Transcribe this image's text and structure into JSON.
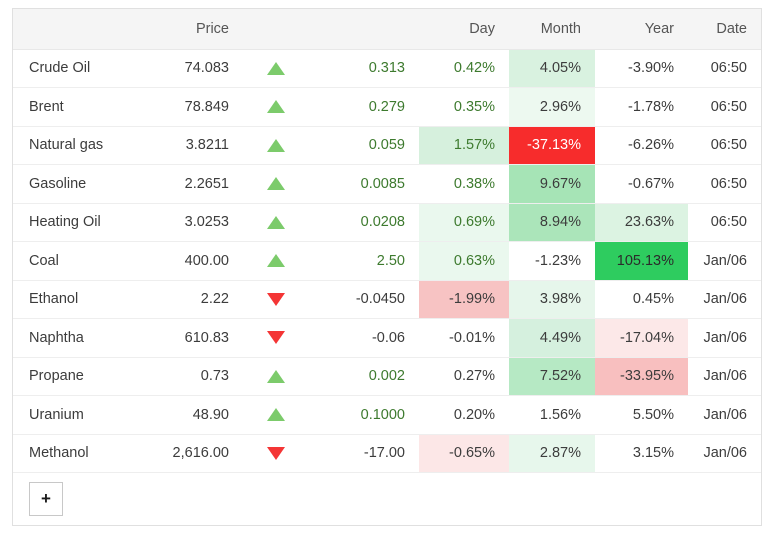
{
  "table": {
    "headers": {
      "name": "",
      "price": "Price",
      "arrow": "",
      "change": "",
      "day": "Day",
      "month": "Month",
      "year": "Year",
      "date": "Date"
    },
    "rows": [
      {
        "name": "Crude Oil",
        "price": "74.083",
        "direction": "up",
        "change": "0.313",
        "day": "0.42%",
        "month": "4.05%",
        "year": "-3.90%",
        "date": "06:50",
        "day_bg": "#ffffff",
        "month_bg": "#d9f2e0",
        "year_bg": "#ffffff",
        "day_color": "#3d7a2e",
        "month_color": "#3c3c3c",
        "year_color": "#3c3c3c"
      },
      {
        "name": "Brent",
        "price": "78.849",
        "direction": "up",
        "change": "0.279",
        "day": "0.35%",
        "month": "2.96%",
        "year": "-1.78%",
        "date": "06:50",
        "day_bg": "#ffffff",
        "month_bg": "#edf9f0",
        "year_bg": "#ffffff",
        "day_color": "#3d7a2e",
        "month_color": "#3c3c3c",
        "year_color": "#3c3c3c"
      },
      {
        "name": "Natural gas",
        "price": "3.8211",
        "direction": "up",
        "change": "0.059",
        "day": "1.57%",
        "month": "-37.13%",
        "year": "-6.26%",
        "date": "06:50",
        "day_bg": "#d6f0dd",
        "month_bg": "#f72c2c",
        "year_bg": "#ffffff",
        "day_color": "#3d7a2e",
        "month_color": "#ffffff",
        "year_color": "#3c3c3c"
      },
      {
        "name": "Gasoline",
        "price": "2.2651",
        "direction": "up",
        "change": "0.0085",
        "day": "0.38%",
        "month": "9.67%",
        "year": "-0.67%",
        "date": "06:50",
        "day_bg": "#ffffff",
        "month_bg": "#a6e4b6",
        "year_bg": "#ffffff",
        "day_color": "#3d7a2e",
        "month_color": "#3c3c3c",
        "year_color": "#3c3c3c"
      },
      {
        "name": "Heating Oil",
        "price": "3.0253",
        "direction": "up",
        "change": "0.0208",
        "day": "0.69%",
        "month": "8.94%",
        "year": "23.63%",
        "date": "06:50",
        "day_bg": "#eaf8ee",
        "month_bg": "#abe5ba",
        "year_bg": "#dcf3e2",
        "day_color": "#3d7a2e",
        "month_color": "#3c3c3c",
        "year_color": "#3c3c3c"
      },
      {
        "name": "Coal",
        "price": "400.00",
        "direction": "up",
        "change": "2.50",
        "day": "0.63%",
        "month": "-1.23%",
        "year": "105.13%",
        "date": "Jan/06",
        "day_bg": "#eaf8ee",
        "month_bg": "#ffffff",
        "year_bg": "#2ecc5f",
        "day_color": "#3d7a2e",
        "month_color": "#3c3c3c",
        "year_color": "#2b2b2b"
      },
      {
        "name": "Ethanol",
        "price": "2.22",
        "direction": "down",
        "change": "-0.0450",
        "day": "-1.99%",
        "month": "3.98%",
        "year": "0.45%",
        "date": "Jan/06",
        "day_bg": "#f7c3c3",
        "month_bg": "#e6f6eb",
        "year_bg": "#ffffff",
        "day_color": "#3c3c3c",
        "month_color": "#3c3c3c",
        "year_color": "#3c3c3c"
      },
      {
        "name": "Naphtha",
        "price": "610.83",
        "direction": "down",
        "change": "-0.06",
        "day": "-0.01%",
        "month": "4.49%",
        "year": "-17.04%",
        "date": "Jan/06",
        "day_bg": "#ffffff",
        "month_bg": "#d5f0de",
        "year_bg": "#fce8e8",
        "day_color": "#3c3c3c",
        "month_color": "#3c3c3c",
        "year_color": "#3c3c3c"
      },
      {
        "name": "Propane",
        "price": "0.73",
        "direction": "up",
        "change": "0.002",
        "day": "0.27%",
        "month": "7.52%",
        "year": "-33.95%",
        "date": "Jan/06",
        "day_bg": "#ffffff",
        "month_bg": "#b6e9c4",
        "year_bg": "#f8bfbf",
        "day_color": "#3c3c3c",
        "month_color": "#3c3c3c",
        "year_color": "#3c3c3c"
      },
      {
        "name": "Uranium",
        "price": "48.90",
        "direction": "up",
        "change": "0.1000",
        "day": "0.20%",
        "month": "1.56%",
        "year": "5.50%",
        "date": "Jan/06",
        "day_bg": "#ffffff",
        "month_bg": "#ffffff",
        "year_bg": "#ffffff",
        "day_color": "#3c3c3c",
        "month_color": "#3c3c3c",
        "year_color": "#3c3c3c"
      },
      {
        "name": "Methanol",
        "price": "2,616.00",
        "direction": "down",
        "change": "-17.00",
        "day": "-0.65%",
        "month": "2.87%",
        "year": "3.15%",
        "date": "Jan/06",
        "day_bg": "#fce7e7",
        "month_bg": "#e7f7ec",
        "year_bg": "#ffffff",
        "day_color": "#3c3c3c",
        "month_color": "#3c3c3c",
        "year_color": "#3c3c3c"
      }
    ]
  },
  "footer": {
    "add_label": "+"
  },
  "colors": {
    "up_arrow": "#7ccb6b",
    "down_arrow": "#f43535",
    "header_bg": "#f5f5f5",
    "positive_text": "#3d7a2e",
    "neutral_text": "#3c3c3c"
  }
}
